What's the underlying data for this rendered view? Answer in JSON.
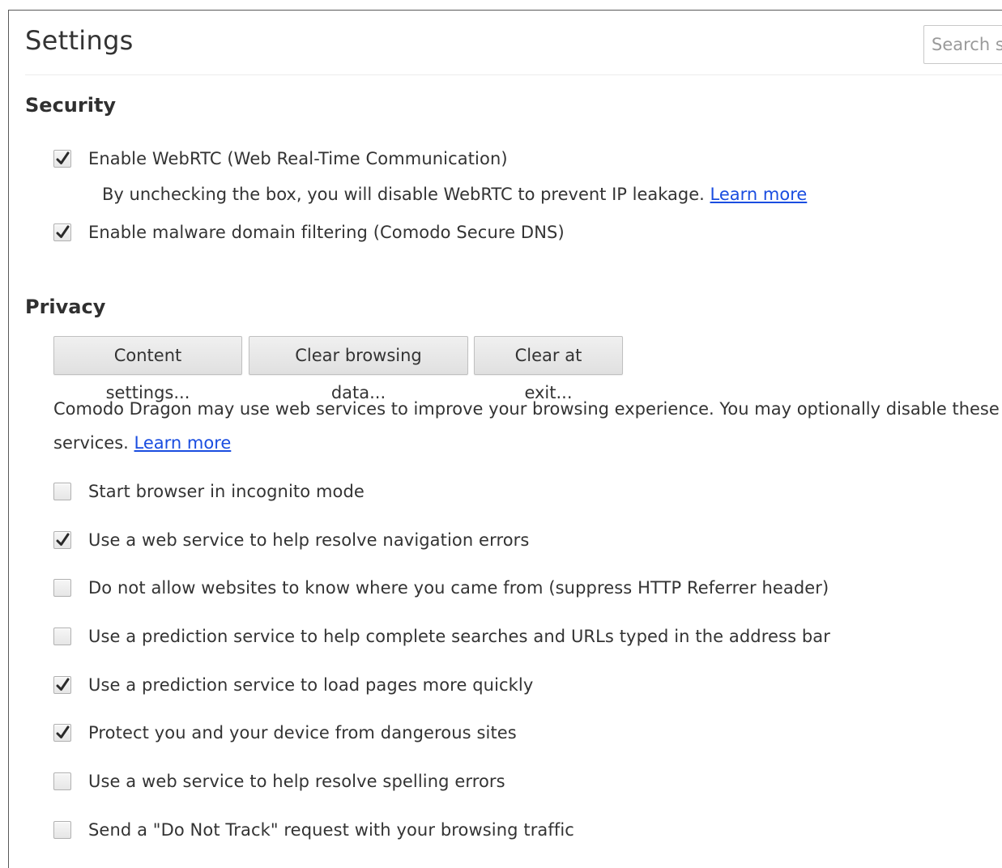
{
  "header": {
    "title": "Settings",
    "search_placeholder": "Search settings"
  },
  "security": {
    "title": "Security",
    "webrtc": {
      "label": "Enable WebRTC (Web Real-Time Communication)",
      "checked": true
    },
    "webrtc_note": "By unchecking the box, you will disable WebRTC to prevent IP leakage.",
    "webrtc_learn_more": "Learn more",
    "malware": {
      "label": "Enable malware domain filtering (Comodo Secure DNS)",
      "checked": true
    }
  },
  "privacy": {
    "title": "Privacy",
    "buttons": {
      "content_settings": "Content settings...",
      "clear_browsing_data": "Clear browsing data...",
      "clear_at_exit": "Clear at exit..."
    },
    "description_line1": "Comodo Dragon may use web services to improve your browsing experience. You may optionally disable these",
    "description_line2": "services.",
    "learn_more": "Learn more",
    "options": [
      {
        "label": "Start browser in incognito mode",
        "checked": false
      },
      {
        "label": "Use a web service to help resolve navigation errors",
        "checked": true
      },
      {
        "label": "Do not allow websites to know where you came from (suppress HTTP Referrer header)",
        "checked": false
      },
      {
        "label": "Use a prediction service to help complete searches and URLs typed in the address bar",
        "checked": false
      },
      {
        "label": "Use a prediction service to load pages more quickly",
        "checked": true
      },
      {
        "label": "Protect you and your device from dangerous sites",
        "checked": true
      },
      {
        "label": "Use a web service to help resolve spelling errors",
        "checked": false
      },
      {
        "label": "Send a \"Do Not Track\" request with your browsing traffic",
        "checked": false
      }
    ]
  },
  "icons": {
    "checkmark": "checkmark-icon"
  }
}
